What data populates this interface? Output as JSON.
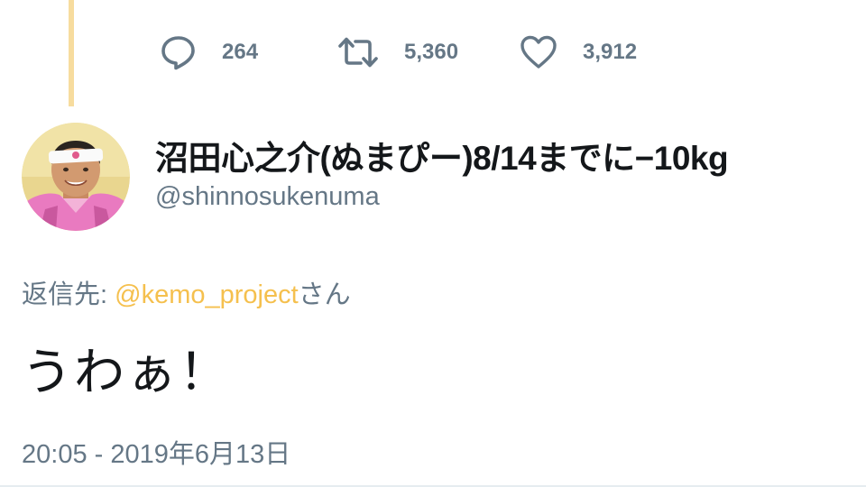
{
  "stats": {
    "replies": "264",
    "retweets": "5,360",
    "likes": "3,912"
  },
  "user": {
    "display_name": "沼田心之介(ぬまぴー)8/14までに−10kg",
    "handle": "@shinnosukenuma"
  },
  "reply_context": {
    "prefix": "返信先: ",
    "mention": "@kemo_project",
    "suffix": "さん"
  },
  "tweet": {
    "text": "うわぁ！",
    "timestamp": "20:05 - 2019年6月13日"
  },
  "icons": {
    "reply": "reply-icon",
    "retweet": "retweet-icon",
    "like": "heart-icon"
  },
  "colors": {
    "thread_line": "#f7dc9e",
    "mention": "#f5c04e",
    "secondary_text": "#657786",
    "primary_text": "#14171a"
  }
}
